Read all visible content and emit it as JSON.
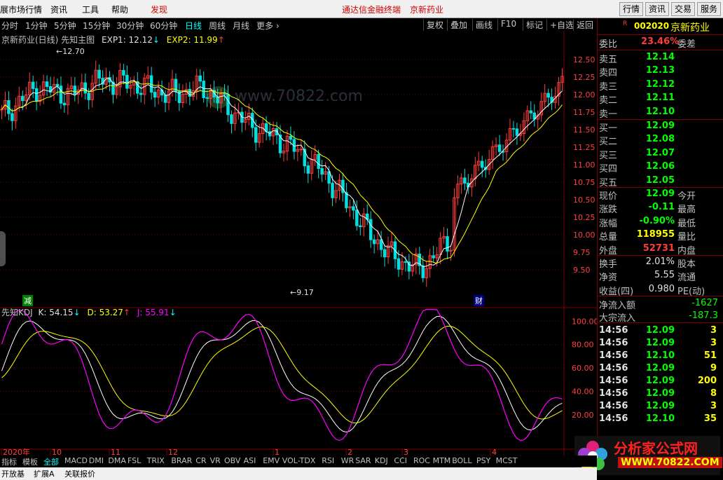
{
  "menubar": {
    "items": [
      "展市场行情",
      "资讯",
      "工具",
      "帮助",
      "发现"
    ],
    "center": "通达信金融终端",
    "stock_name": "京新药业",
    "right_buttons": [
      "行情",
      "资讯",
      "交易",
      "服务"
    ]
  },
  "periods": [
    "分时",
    "1分钟",
    "5分钟",
    "15分钟",
    "30分钟",
    "60分钟",
    "日线",
    "周线",
    "月线",
    "更多 ›"
  ],
  "toolbar": [
    "复权",
    "叠加",
    "画线",
    "F10",
    "标记",
    "+自选",
    "返回"
  ],
  "main_title": {
    "name": "京新药业(日线) 先知主图",
    "exp1": "EXP1: 12.12",
    "exp2": "EXP2: 11.99",
    "exp1_arrow": "↓",
    "exp2_arrow": "↑"
  },
  "kdj_title": {
    "name": "先知KDJ",
    "k": "K: 54.15",
    "d": "D: 53.27",
    "j": "J: 55.91",
    "k_arrow": "↓",
    "d_arrow": "↑",
    "j_arrow": "↓"
  },
  "high_label": "12.70",
  "low_label": "9.17",
  "price_axis": [
    "12.50",
    "12.25",
    "12.00",
    "11.75",
    "11.50",
    "11.25",
    "11.00",
    "10.75",
    "10.50",
    "10.25",
    "10.00",
    "9.75",
    "9.50"
  ],
  "kdj_axis": [
    "100.00",
    "80.00",
    "60.00",
    "40.00",
    "20.00"
  ],
  "date_axis": [
    {
      "t": "2020年"
    },
    {
      "t": "10"
    },
    {
      "t": "11"
    },
    {
      "t": "12"
    },
    {
      "t": "1"
    },
    {
      "t": "2"
    },
    {
      "t": "3"
    },
    {
      "t": "4"
    }
  ],
  "markers": {
    "jian": "减",
    "cai": "财"
  },
  "watermark": {
    "site": "www.70822.com",
    "logo_text": "分析家公式网",
    "logo_url": "WWW.70822.COM"
  },
  "quote": {
    "code": "002020",
    "name": "京新药业",
    "r_badge": "R",
    "weibi": {
      "label": "委比",
      "value": "23.46%",
      "label2": "委差"
    },
    "sell": [
      {
        "l": "卖五",
        "p": "12.14"
      },
      {
        "l": "卖四",
        "p": "12.13"
      },
      {
        "l": "卖三",
        "p": "12.12"
      },
      {
        "l": "卖二",
        "p": "12.11"
      },
      {
        "l": "卖一",
        "p": "12.10"
      }
    ],
    "buy": [
      {
        "l": "买一",
        "p": "12.09"
      },
      {
        "l": "买二",
        "p": "12.08"
      },
      {
        "l": "买三",
        "p": "12.07"
      },
      {
        "l": "买四",
        "p": "12.06"
      },
      {
        "l": "买五",
        "p": "12.05"
      }
    ],
    "stats": [
      {
        "l": "现价",
        "v": "12.09",
        "c": "g",
        "l2": "今开"
      },
      {
        "l": "涨跌",
        "v": "-0.11",
        "c": "g",
        "l2": "最高"
      },
      {
        "l": "涨幅",
        "v": "-0.90%",
        "c": "g",
        "l2": "最低"
      },
      {
        "l": "总量",
        "v": "118955",
        "c": "y",
        "l2": "量比"
      },
      {
        "l": "外盘",
        "v": "52731",
        "c": "r",
        "l2": "内盘"
      }
    ],
    "stats2": [
      {
        "l": "换手",
        "v": "2.01%",
        "l2": "股本"
      },
      {
        "l": "净资",
        "v": "5.55",
        "l2": "流通"
      },
      {
        "l": "收益(四)",
        "v": "0.980",
        "l2": "PE(动)"
      }
    ],
    "flows": [
      {
        "l": "净流入额",
        "v": "-1627"
      },
      {
        "l": "大宗流入",
        "v": "-187.3"
      }
    ],
    "ticks": [
      {
        "t": "14:56",
        "p": "12.09",
        "v": "3"
      },
      {
        "t": "14:56",
        "p": "12.09",
        "v": "3"
      },
      {
        "t": "14:56",
        "p": "12.10",
        "v": "51"
      },
      {
        "t": "14:56",
        "p": "12.09",
        "v": "9"
      },
      {
        "t": "14:56",
        "p": "12.09",
        "v": "200"
      },
      {
        "t": "14:56",
        "p": "12.09",
        "v": "8"
      },
      {
        "t": "14:56",
        "p": "12.09",
        "v": "3"
      },
      {
        "t": "14:56",
        "p": "12.10",
        "v": "35"
      }
    ]
  },
  "tabs": [
    "指标",
    "模板",
    "全部",
    "MACD",
    "DMI",
    "DMA",
    "FSL",
    "TRIX",
    "BRAR",
    "CR",
    "VR",
    "OBV",
    "ASI",
    "EMV",
    "VOL-TDX",
    "RSI",
    "WR",
    "SAR",
    "KDJ",
    "CCI",
    "ROC",
    "MTM",
    "BOLL",
    "PSY",
    "MCST"
  ],
  "bottom_tabs": [
    "开放基",
    "扩展A",
    "关联报价"
  ]
}
